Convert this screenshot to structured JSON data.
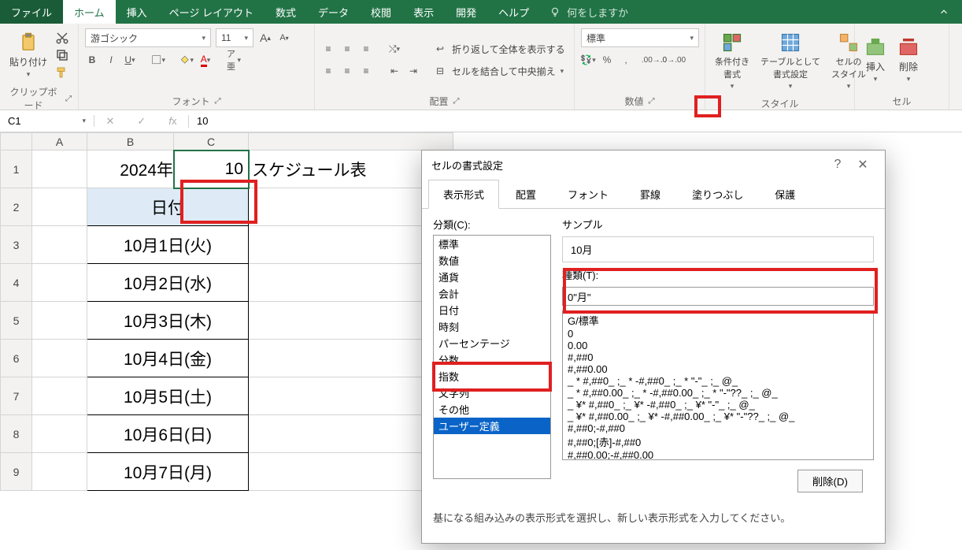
{
  "titlebar": {
    "file": "ファイル",
    "home": "ホーム",
    "insert": "挿入",
    "pagelayout": "ページ レイアウト",
    "formulas": "数式",
    "data": "データ",
    "review": "校閲",
    "view": "表示",
    "developer": "開発",
    "help": "ヘルプ",
    "tellme": "何をしますか"
  },
  "ribbon": {
    "clipboard": {
      "paste": "貼り付け",
      "label": "クリップボード"
    },
    "font": {
      "family": "游ゴシック",
      "size": "11",
      "label": "フォント"
    },
    "alignment": {
      "wrap": "折り返して全体を表示する",
      "merge": "セルを結合して中央揃え",
      "label": "配置"
    },
    "number": {
      "format": "標準",
      "label": "数値"
    },
    "styles": {
      "cond": "条件付き\n書式",
      "table": "テーブルとして\n書式設定",
      "cell": "セルの\nスタイル",
      "label": "スタイル"
    },
    "cells": {
      "insert": "挿入",
      "delete": "削除",
      "label": "セル"
    }
  },
  "fbar": {
    "name": "C1",
    "value": "10"
  },
  "sheet": {
    "cols": [
      "A",
      "B",
      "C"
    ],
    "b1": "2024年",
    "c1": "10",
    "d1": "スケジュール表",
    "header": "日付",
    "rows": [
      "10月1日(火)",
      "10月2日(水)",
      "10月3日(木)",
      "10月4日(金)",
      "10月5日(土)",
      "10月6日(日)",
      "10月7日(月)"
    ]
  },
  "dialog": {
    "title": "セルの書式設定",
    "tabs": [
      "表示形式",
      "配置",
      "フォント",
      "罫線",
      "塗りつぶし",
      "保護"
    ],
    "category_label": "分類(C):",
    "categories": [
      "標準",
      "数値",
      "通貨",
      "会計",
      "日付",
      "時刻",
      "パーセンテージ",
      "分数",
      "指数",
      "文字列",
      "その他",
      "ユーザー定義"
    ],
    "sample_label": "サンプル",
    "sample_value": "10月",
    "type_label": "種類(T):",
    "type_value": "0\"月\"",
    "formats": [
      "G/標準",
      "0",
      "0.00",
      "#,##0",
      "#,##0.00",
      "_ * #,##0_ ;_ * -#,##0_ ;_ * \"-\"_ ;_ @_",
      "_ * #,##0.00_ ;_ * -#,##0.00_ ;_ * \"-\"??_ ;_ @_",
      "_ ¥* #,##0_ ;_ ¥* -#,##0_ ;_ ¥* \"-\"_ ;_ @_",
      "_ ¥* #,##0.00_ ;_ ¥* -#,##0.00_ ;_ ¥* \"-\"??_ ;_ @_",
      "#,##0;-#,##0",
      "#,##0;[赤]-#,##0",
      "#,##0.00;-#,##0.00"
    ],
    "delete_btn": "削除(D)",
    "hint": "基になる組み込みの表示形式を選択し、新しい表示形式を入力してください。"
  }
}
